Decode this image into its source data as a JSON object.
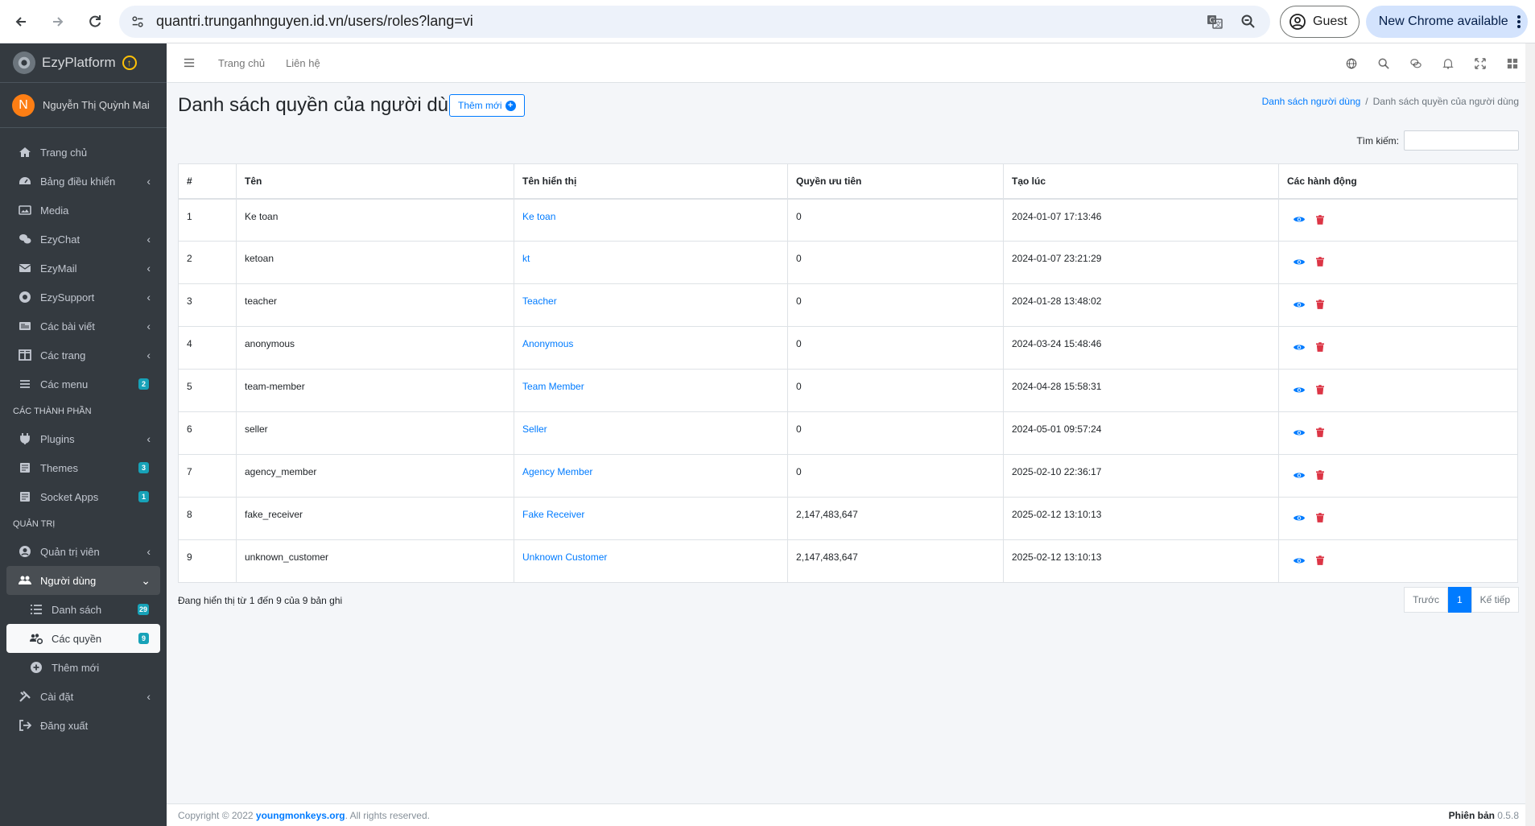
{
  "browser": {
    "url": "quantri.trunganhnguyen.id.vn/users/roles?lang=vi",
    "guest_label": "Guest",
    "update_label": "New Chrome available"
  },
  "sidebar": {
    "brand": "EzyPlatform",
    "user_initial": "N",
    "user_name": "Nguyễn Thị Quỳnh Mai",
    "items": [
      {
        "label": "Trang chủ",
        "icon": "home-icon"
      },
      {
        "label": "Bảng điều khiển",
        "icon": "dashboard-icon"
      },
      {
        "label": "Media",
        "icon": "image-icon"
      },
      {
        "label": "EzyChat",
        "icon": "chat-icon"
      },
      {
        "label": "EzyMail",
        "icon": "mail-icon"
      },
      {
        "label": "EzySupport",
        "icon": "support-icon"
      },
      {
        "label": "Các bài viết",
        "icon": "newspaper-icon"
      },
      {
        "label": "Các trang",
        "icon": "columns-icon"
      },
      {
        "label": "Các menu",
        "icon": "bars-icon",
        "badge": "2"
      }
    ],
    "header_components": "CÁC THÀNH PHẦN",
    "components": [
      {
        "label": "Plugins",
        "icon": "plug-icon"
      },
      {
        "label": "Themes",
        "icon": "theme-icon",
        "badge": "3"
      },
      {
        "label": "Socket Apps",
        "icon": "socket-icon",
        "badge": "1"
      }
    ],
    "header_admin": "QUẢN TRỊ",
    "admin": [
      {
        "label": "Quản trị viên",
        "icon": "user-circle-icon"
      },
      {
        "label": "Người dùng",
        "icon": "users-icon"
      }
    ],
    "users_sub": [
      {
        "label": "Danh sách",
        "icon": "list-icon",
        "badge": "29"
      },
      {
        "label": "Các quyền",
        "icon": "users-cog-icon",
        "badge": "9"
      },
      {
        "label": "Thêm mới",
        "icon": "plus-circle-icon"
      }
    ],
    "bottom": [
      {
        "label": "Cài đặt",
        "icon": "tools-icon"
      },
      {
        "label": "Đăng xuất",
        "icon": "sign-out-icon"
      }
    ]
  },
  "topnav": {
    "home": "Trang chủ",
    "contact": "Liên hệ"
  },
  "page": {
    "title": "Danh sách quyền của người dùng",
    "add_label": "Thêm mới",
    "breadcrumb_link": "Danh sách người dùng",
    "breadcrumb_sep": "/",
    "breadcrumb_current": "Danh sách quyền của người dùng",
    "search_label": "Tìm kiếm:"
  },
  "table": {
    "headers": [
      "#",
      "Tên",
      "Tên hiển thị",
      "Quyền ưu tiên",
      "Tạo lúc",
      "Các hành động"
    ],
    "rows": [
      [
        "1",
        "Ke toan",
        "Ke toan",
        "0",
        "2024-01-07 17:13:46"
      ],
      [
        "2",
        "ketoan",
        "kt",
        "0",
        "2024-01-07 23:21:29"
      ],
      [
        "3",
        "teacher",
        "Teacher",
        "0",
        "2024-01-28 13:48:02"
      ],
      [
        "4",
        "anonymous",
        "Anonymous",
        "0",
        "2024-03-24 15:48:46"
      ],
      [
        "5",
        "team-member",
        "Team Member",
        "0",
        "2024-04-28 15:58:31"
      ],
      [
        "6",
        "seller",
        "Seller",
        "0",
        "2024-05-01 09:57:24"
      ],
      [
        "7",
        "agency_member",
        "Agency Member",
        "0",
        "2025-02-10 22:36:17"
      ],
      [
        "8",
        "fake_receiver",
        "Fake Receiver",
        "2,147,483,647",
        "2025-02-12 13:10:13"
      ],
      [
        "9",
        "unknown_customer",
        "Unknown Customer",
        "2,147,483,647",
        "2025-02-12 13:10:13"
      ]
    ]
  },
  "pagination": {
    "info": "Đang hiển thị từ 1 đến 9 của 9 bản ghi",
    "prev": "Trước",
    "current": "1",
    "next": "Kế tiếp"
  },
  "footer": {
    "copyright": "Copyright © 2022",
    "brand_link": "youngmonkeys.org",
    "rights": ". All rights reserved.",
    "version_label": "Phiên bản",
    "version": "0.5.8"
  },
  "colors": {
    "sidebar_bg": "#343a40",
    "primary": "#007bff",
    "danger": "#dc3545",
    "badge": "#17a2b8"
  }
}
